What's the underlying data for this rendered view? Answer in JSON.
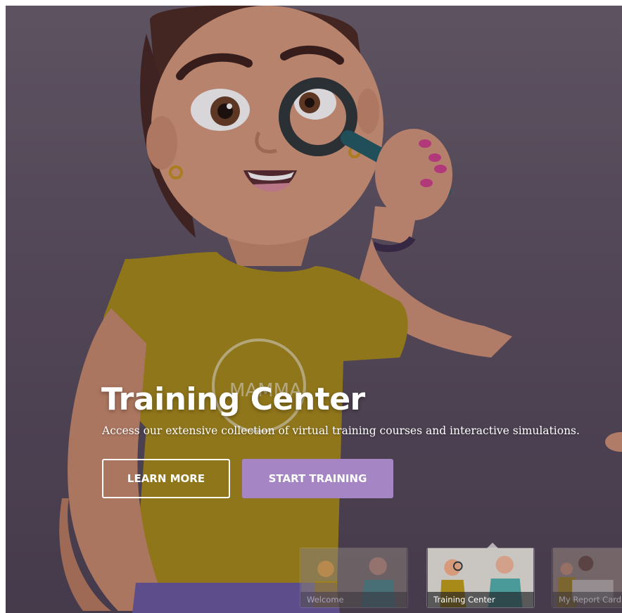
{
  "hero": {
    "title": "Training Center",
    "subtitle": "Access our extensive collection of virtual training courses and interactive simulations.",
    "shirt_text": "MAMMA",
    "buttons": {
      "learn_more": "LEARN MORE",
      "start_training": "START TRAINING"
    }
  },
  "thumbnails": [
    {
      "label": "Welcome",
      "active": false
    },
    {
      "label": "Training Center",
      "active": true
    },
    {
      "label": "My Report Card",
      "active": false
    }
  ],
  "colors": {
    "accent": "#a585c3",
    "background": "#5b5060",
    "shirt": "#a88a18",
    "skin": "#d79a7a"
  }
}
